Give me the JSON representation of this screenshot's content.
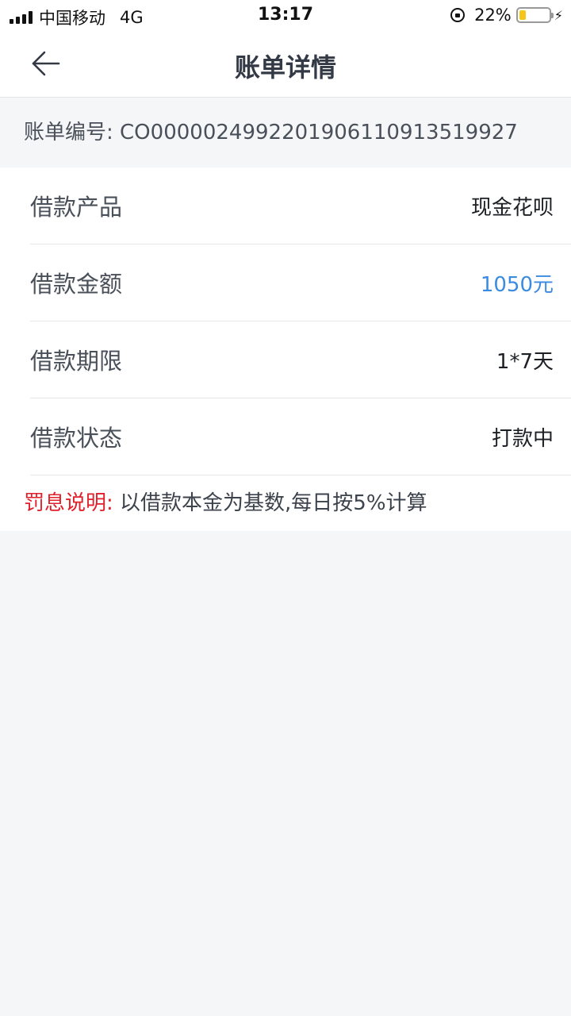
{
  "status_bar": {
    "carrier": "中国移动",
    "network": "4G",
    "time": "13:17",
    "battery_percent": "22%",
    "battery_level": 0.22,
    "battery_color": "#f5c518"
  },
  "header": {
    "title": "账单详情",
    "back_icon": "arrow-left-icon"
  },
  "bill": {
    "number_label": "账单编号: ",
    "number_value": "CO00000249922019061109135 19927"
  },
  "details": [
    {
      "label": "借款产品",
      "value": "现金花呗"
    },
    {
      "label": "借款金额",
      "value": "1050元",
      "accent_color": "#3b8be0"
    },
    {
      "label": "借款期限",
      "value": "1*7天"
    },
    {
      "label": "借款状态",
      "value": "打款中"
    }
  ],
  "penalty": {
    "label": "罚息说明:",
    "text": " 以借款本金为基数,每日按5%计算",
    "label_color": "#e0202a"
  }
}
